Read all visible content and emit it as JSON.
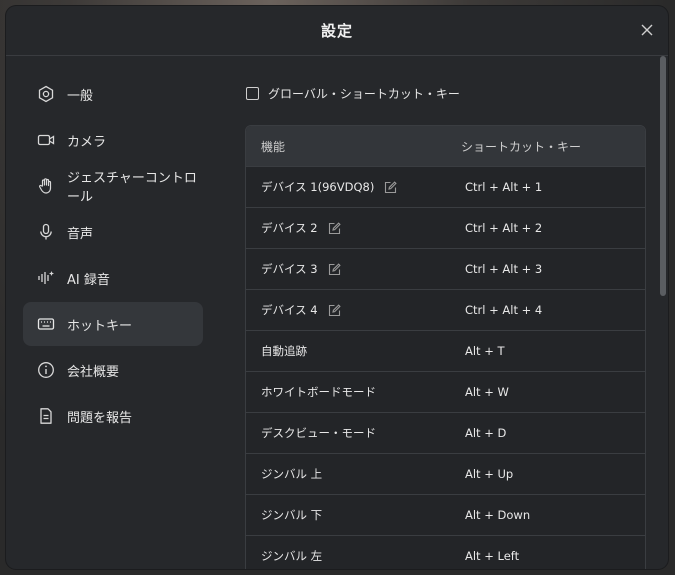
{
  "dialog": {
    "title": "設定"
  },
  "sidebar": {
    "items": [
      {
        "label": "一般",
        "icon": "hexagon-settings-icon",
        "active": false
      },
      {
        "label": "カメラ",
        "icon": "camera-icon",
        "active": false
      },
      {
        "label": "ジェスチャーコントロール",
        "icon": "hand-icon",
        "active": false
      },
      {
        "label": "音声",
        "icon": "microphone-icon",
        "active": false
      },
      {
        "label": "AI 録音",
        "icon": "ai-waveform-icon",
        "active": false
      },
      {
        "label": "ホットキー",
        "icon": "keyboard-icon",
        "active": true
      },
      {
        "label": "会社概要",
        "icon": "info-icon",
        "active": false
      },
      {
        "label": "問題を報告",
        "icon": "report-document-icon",
        "active": false
      }
    ]
  },
  "global_shortcut": {
    "label": "グローバル・ショートカット・キー",
    "checked": false
  },
  "table": {
    "headers": {
      "function": "機能",
      "shortcut": "ショートカット・キー"
    },
    "rows": [
      {
        "function": "デバイス 1(96VDQ8)",
        "shortcut": "Ctrl + Alt + 1",
        "editable": true
      },
      {
        "function": "デバイス 2",
        "shortcut": "Ctrl + Alt + 2",
        "editable": true
      },
      {
        "function": "デバイス 3",
        "shortcut": "Ctrl + Alt + 3",
        "editable": true
      },
      {
        "function": "デバイス 4",
        "shortcut": "Ctrl + Alt + 4",
        "editable": true
      },
      {
        "function": "自動追跡",
        "shortcut": "Alt + T",
        "editable": false
      },
      {
        "function": "ホワイトボードモード",
        "shortcut": "Alt + W",
        "editable": false
      },
      {
        "function": "デスクビュー・モード",
        "shortcut": "Alt + D",
        "editable": false
      },
      {
        "function": "ジンバル 上",
        "shortcut": "Alt + Up",
        "editable": false
      },
      {
        "function": "ジンバル 下",
        "shortcut": "Alt + Down",
        "editable": false
      },
      {
        "function": "ジンバル 左",
        "shortcut": "Alt + Left",
        "editable": false
      }
    ]
  }
}
